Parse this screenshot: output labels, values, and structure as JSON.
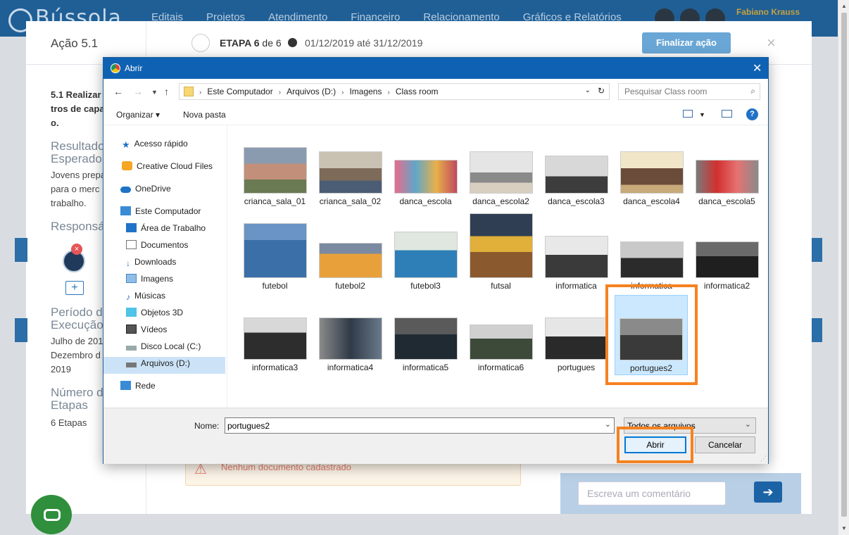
{
  "app": {
    "logo": "Bússola",
    "nav": [
      "Editais",
      "Projetos",
      "Atendimento",
      "Financeiro",
      "Relacionamento",
      "Gráficos e Relatórios"
    ],
    "user_name": "Fabiano Krauss"
  },
  "modal": {
    "title": "Ação 5.1",
    "step_prefix": "ETAPA 6",
    "step_suffix": "de 6",
    "dates": "01/12/2019 até 31/12/2019",
    "finalize_label": "Finalizar ação",
    "close_glyph": "×",
    "left": {
      "action_text_1": "5.1 Realizar",
      "action_text_2": "tros de capa",
      "action_text_3": "o.",
      "result_heading_1": "Resultado",
      "result_heading_2": "Esperado",
      "result_text_1": "Jovens prepa",
      "result_text_2": "para o merc",
      "result_text_3": "trabalho.",
      "responsible_heading": "Responsá",
      "period_heading_1": "Período d",
      "period_heading_2": "Execução",
      "period_text_1": "Julho de 201",
      "period_text_2": "Dezembro d",
      "period_text_3": "2019",
      "steps_heading_1": "Número d",
      "steps_heading_2": "Etapas",
      "steps_text": "6 Etapas"
    },
    "warning": "Nenhum documento cadastrado",
    "comment_placeholder": "Escreva um comentário",
    "send_glyph": "➔"
  },
  "dialog": {
    "title": "Abrir",
    "breadcrumb": [
      "Este Computador",
      "Arquivos (D:)",
      "Imagens",
      "Class room"
    ],
    "search_placeholder": "Pesquisar Class room",
    "organize_label": "Organizar ▾",
    "new_folder_label": "Nova pasta",
    "sidebar": [
      {
        "label": "Acesso rápido",
        "icon": "star-icon"
      },
      {
        "label": "Creative Cloud Files",
        "icon": "creative-cloud-icon"
      },
      {
        "label": "OneDrive",
        "icon": "cloud-icon"
      },
      {
        "label": "Este Computador",
        "icon": "computer-icon"
      },
      {
        "label": "Área de Trabalho",
        "icon": "desktop-icon"
      },
      {
        "label": "Documentos",
        "icon": "document-icon"
      },
      {
        "label": "Downloads",
        "icon": "download-icon"
      },
      {
        "label": "Imagens",
        "icon": "image-icon"
      },
      {
        "label": "Músicas",
        "icon": "music-icon"
      },
      {
        "label": "Objetos 3D",
        "icon": "cube-icon"
      },
      {
        "label": "Vídeos",
        "icon": "video-icon"
      },
      {
        "label": "Disco Local (C:)",
        "icon": "drive-icon"
      },
      {
        "label": "Arquivos (D:)",
        "icon": "drive-icon"
      },
      {
        "label": "Rede",
        "icon": "network-icon"
      }
    ],
    "files": [
      "crianca_sala_01",
      "crianca_sala_02",
      "danca_escola",
      "danca_escola2",
      "danca_escola3",
      "danca_escola4",
      "danca_escola5",
      "futebol",
      "futebol2",
      "futebol3",
      "futsal",
      "informatica",
      "informatica",
      "informatica2",
      "informatica3",
      "informatica4",
      "informatica5",
      "informatica6",
      "portugues",
      "portugues2"
    ],
    "name_label": "Nome:",
    "name_value": "portugues2",
    "file_type": "Todos os arquivos",
    "open_label": "Abrir",
    "cancel_label": "Cancelar"
  }
}
